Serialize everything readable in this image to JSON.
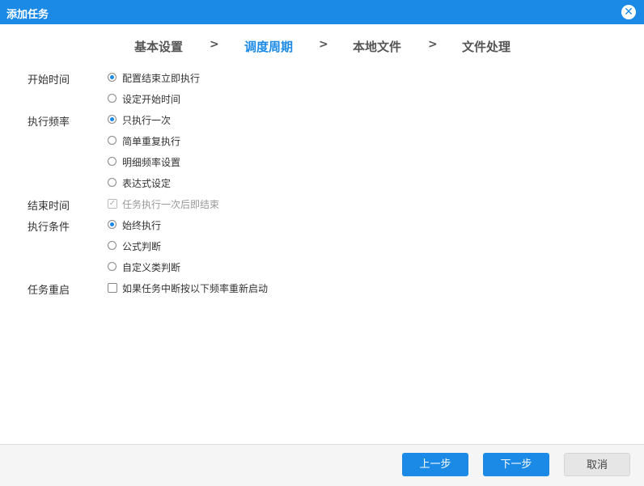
{
  "dialog": {
    "title": "添加任务",
    "close_icon": "close-circle-icon"
  },
  "steps": [
    {
      "label": "基本设置"
    },
    {
      "label": "调度周期",
      "active": true
    },
    {
      "label": "本地文件"
    },
    {
      "label": "文件处理"
    }
  ],
  "step_separator": ">",
  "form": {
    "start_time": {
      "label": "开始时间",
      "options": [
        "配置结束立即执行",
        "设定开始时间"
      ],
      "selected": 0
    },
    "frequency": {
      "label": "执行频率",
      "options": [
        "只执行一次",
        "简单重复执行",
        "明细频率设置",
        "表达式设定"
      ],
      "selected": 0
    },
    "end_time": {
      "label": "结束时间",
      "checkbox_label": "任务执行一次后即结束",
      "checked": true,
      "disabled": true
    },
    "condition": {
      "label": "执行条件",
      "options": [
        "始终执行",
        "公式判断",
        "自定义类判断"
      ],
      "selected": 0
    },
    "restart": {
      "label": "任务重启",
      "checkbox_label": "如果任务中断按以下频率重新启动",
      "checked": false
    }
  },
  "footer": {
    "prev_label": "上一步",
    "next_label": "下一步",
    "cancel_label": "取消"
  },
  "colors": {
    "accent": "#1a8ae6"
  }
}
